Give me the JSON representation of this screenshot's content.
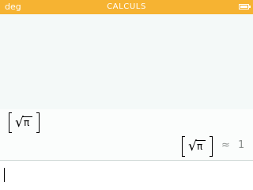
{
  "status_bar": {
    "angle_mode": "deg",
    "app_title": "CALCULS",
    "battery_icon": "battery-full-icon",
    "background_color": "#f6b332"
  },
  "history": [
    {
      "input": {
        "type": "matrix-1x1",
        "radicand": "π"
      },
      "output": {
        "type": "matrix-1x1",
        "radicand": "π"
      },
      "approx_symbol": "≈",
      "approx_value": "1"
    }
  ],
  "input_bar": {
    "value": ""
  }
}
